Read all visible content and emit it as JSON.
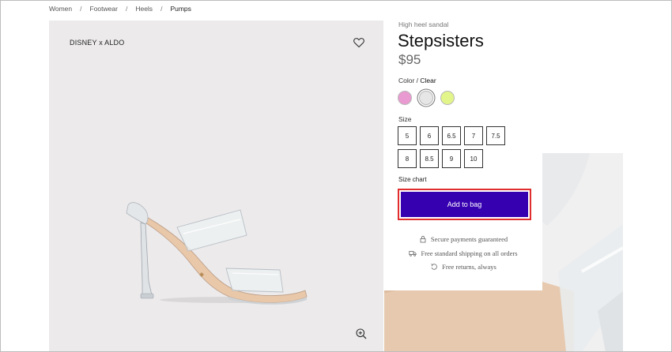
{
  "breadcrumb": {
    "items": [
      "Women",
      "Footwear",
      "Heels",
      "Pumps"
    ],
    "separator": "/"
  },
  "gallery": {
    "brand": "DISNEY x ALDO",
    "icons": {
      "wishlist": "heart-icon",
      "zoom": "zoom-in-icon"
    }
  },
  "product": {
    "subtitle": "High heel sandal",
    "title": "Stepsisters",
    "price": "$95",
    "color_label": "Color",
    "color_separator": " / ",
    "selected_color": "Clear",
    "swatches": [
      {
        "name": "pink",
        "hex": "#e99ad0"
      },
      {
        "name": "clear",
        "hex": "#e6e6e6",
        "selected": true
      },
      {
        "name": "lime",
        "hex": "#e2f58a"
      }
    ],
    "size_label": "Size",
    "sizes": [
      "5",
      "6",
      "6.5",
      "7",
      "7.5",
      "8",
      "8.5",
      "9",
      "10"
    ],
    "size_chart_label": "Size chart",
    "add_to_bag_label": "Add to bag",
    "perks": [
      {
        "icon": "lock-icon",
        "text": "Secure payments guaranteed"
      },
      {
        "icon": "truck-icon",
        "text": "Free standard shipping on all orders"
      },
      {
        "icon": "return-icon",
        "text": "Free returns, always"
      }
    ]
  },
  "colors": {
    "accent": "#3600b1",
    "highlight_border": "#e02d2d",
    "gallery_bg": "#eceaeb"
  }
}
